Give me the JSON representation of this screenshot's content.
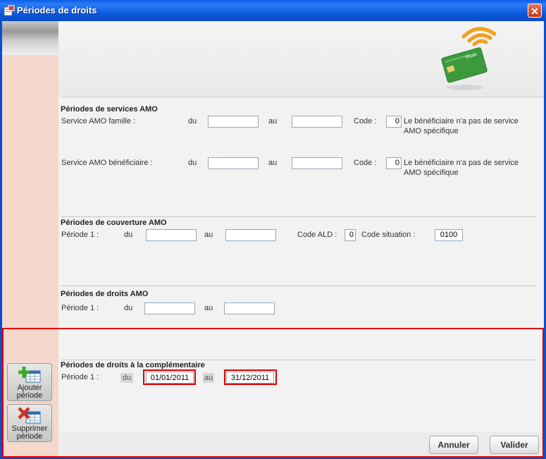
{
  "window": {
    "title": "Périodes de droits",
    "close_glyph": "✕"
  },
  "logo": {
    "card_text": "vitale",
    "card_small": "carte d'assurance maladie"
  },
  "services_amo": {
    "title": "Périodes de services AMO",
    "rows": [
      {
        "label": "Service AMO famille :",
        "du": "du",
        "au": "au",
        "du_value": "",
        "au_value": "",
        "code_label": "Code :",
        "code": "0",
        "info": "Le bénéficiaire n'a pas de service AMO spécifique"
      },
      {
        "label": "Service AMO bénéficiaire :",
        "du": "du",
        "au": "au",
        "du_value": "",
        "au_value": "",
        "code_label": "Code :",
        "code": "0",
        "info": "Le bénéficiaire n'a pas de service AMO spécifique"
      }
    ]
  },
  "couverture_amo": {
    "title": "Périodes de couverture AMO",
    "row": {
      "label": "Période 1 :",
      "du": "du",
      "au": "au",
      "du_value": "",
      "au_value": "",
      "ald_label": "Code ALD :",
      "ald": "0",
      "situation_label": "Code situation :",
      "situation": "0100"
    }
  },
  "droits_amo": {
    "title": "Périodes de droits AMO",
    "row": {
      "label": "Période 1 :",
      "du": "du",
      "au": "au",
      "du_value": "",
      "au_value": ""
    }
  },
  "complementaire": {
    "title": "Périodes de droits à la complémentaire",
    "row": {
      "label": "Période 1 :",
      "du": "du",
      "au": "au",
      "du_value": "01/01/2011",
      "au_value": "31/12/2011"
    }
  },
  "side_buttons": {
    "add": {
      "line1": "Ajouter",
      "line2": "période",
      "icon": "calendar-add-icon"
    },
    "remove": {
      "line1": "Supprimer",
      "line2": "période",
      "icon": "calendar-remove-icon"
    }
  },
  "footer": {
    "cancel": "Annuler",
    "ok": "Valider"
  },
  "colors": {
    "title_bar": "#0b56d8",
    "sidebar": "#f4d8cc",
    "highlight": "#e00000",
    "card_green": "#3c9a3c",
    "signal_orange": "#f0a020"
  }
}
